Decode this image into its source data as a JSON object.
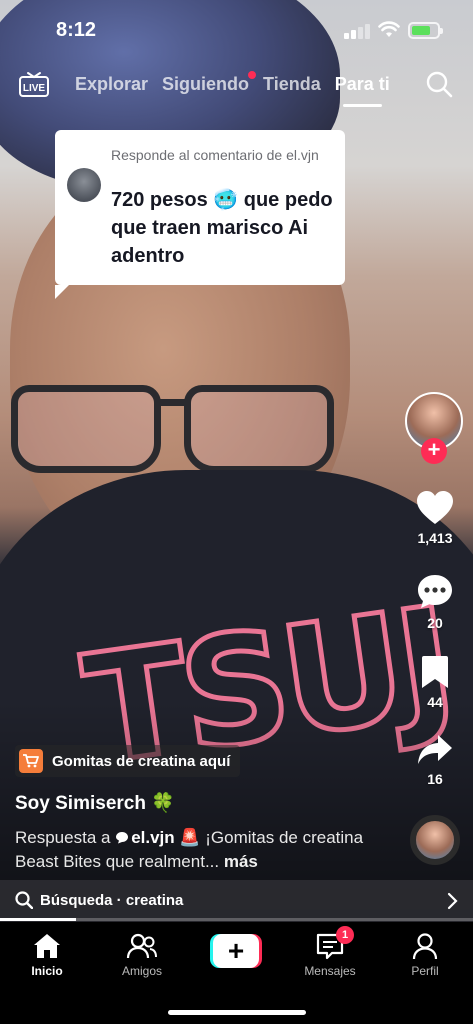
{
  "status_bar": {
    "time": "8:12"
  },
  "top_nav": {
    "live_label": "LIVE",
    "tabs": [
      {
        "label": "Explorar",
        "active": false
      },
      {
        "label": "Siguiendo",
        "active": false,
        "dot": true
      },
      {
        "label": "Tienda",
        "active": false
      },
      {
        "label": "Para ti",
        "active": true
      }
    ]
  },
  "reply_bubble": {
    "header": "Responde al comentario de el.vjn",
    "text": "720 pesos 🥶 que pedo que traen marisco Ai adentro"
  },
  "actions": {
    "likes": "1,413",
    "comments": "20",
    "saves": "44",
    "shares": "16"
  },
  "post": {
    "product_label": "Gomitas de creatina aquí",
    "username": "Soy Simiserch 🍀",
    "caption_prefix": "Respuesta a ",
    "caption_mention": "el.vjn",
    "caption_text": " 🚨 ¡Gomitas de creatina Beast Bites que realment...",
    "caption_more": " más"
  },
  "search_suggestion": {
    "text": "Búsqueda · creatina"
  },
  "progress": {
    "fraction": 0.16
  },
  "bottom_nav": {
    "items": [
      {
        "label": "Inicio",
        "active": true
      },
      {
        "label": "Amigos",
        "active": false
      },
      {
        "label": "Mensajes",
        "active": false,
        "badge": "1"
      },
      {
        "label": "Perfil",
        "active": false
      }
    ]
  },
  "colors": {
    "accent": "#fe2c55",
    "cyan": "#25f4ee",
    "product": "#f57d3a"
  }
}
